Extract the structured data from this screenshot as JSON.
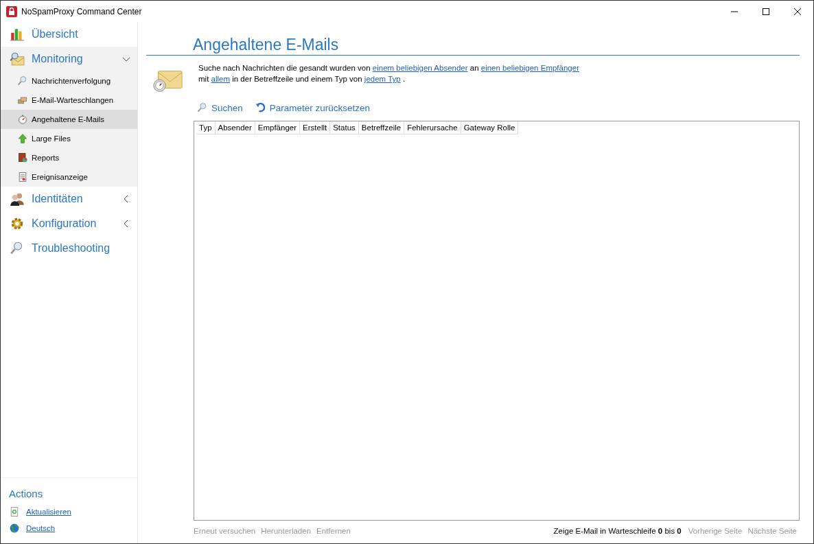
{
  "window": {
    "title": "NoSpamProxy Command Center"
  },
  "sidebar": {
    "items": [
      {
        "label": "Übersicht",
        "selected": false
      },
      {
        "label": "Monitoring",
        "selected": false,
        "expanded": true,
        "children": [
          {
            "label": "Nachrichtenverfolgung",
            "selected": false
          },
          {
            "label": "E-Mail-Warteschlangen",
            "selected": false
          },
          {
            "label": "Angehaltene E-Mails",
            "selected": true
          },
          {
            "label": "Large Files",
            "selected": false
          },
          {
            "label": "Reports",
            "selected": false
          },
          {
            "label": "Ereignisanzeige",
            "selected": false
          }
        ]
      },
      {
        "label": "Identitäten",
        "selected": false,
        "expanded": false
      },
      {
        "label": "Konfiguration",
        "selected": false,
        "expanded": false
      },
      {
        "label": "Troubleshooting",
        "selected": false
      }
    ],
    "actions_title": "Actions",
    "actions": [
      {
        "label": "Aktualisieren"
      },
      {
        "label": "Deutsch"
      }
    ]
  },
  "page": {
    "title": "Angehaltene E-Mails",
    "description": [
      [
        {
          "kind": "text",
          "text": "Suche nach Nachrichten die gesandt wurden von "
        },
        {
          "kind": "link",
          "text": "einem beliebigen Absender"
        },
        {
          "kind": "text",
          "text": " an "
        },
        {
          "kind": "link",
          "text": "einen beliebigen Empfänger"
        }
      ],
      [
        {
          "kind": "text",
          "text": "mit "
        },
        {
          "kind": "link",
          "text": "allem"
        },
        {
          "kind": "text",
          "text": " in der Betreffzeile und einem Typ von "
        },
        {
          "kind": "link",
          "text": "jedem Typ"
        },
        {
          "kind": "text",
          "text": "  ."
        }
      ]
    ],
    "toolbar": [
      {
        "label": "Suchen"
      },
      {
        "label": "Parameter zurücksetzen"
      }
    ],
    "table": {
      "columns": [
        "Typ",
        "Absender",
        "Empfänger",
        "Erstellt",
        "Status",
        "Betreffzeile",
        "Fehlerursache",
        "Gateway Rolle"
      ]
    },
    "footer": {
      "actions": [
        {
          "label": "Erneut versuchen",
          "disabled": true
        },
        {
          "label": "Herunterladen",
          "disabled": true
        },
        {
          "label": "Entfernen",
          "disabled": true
        }
      ],
      "paging_text": "Zeige E-Mail in Warteschleife **0** bis **0**",
      "paging": [
        {
          "label": "Vorherige Seite",
          "disabled": true
        },
        {
          "label": "Nächste Seite",
          "disabled": true
        }
      ]
    }
  }
}
